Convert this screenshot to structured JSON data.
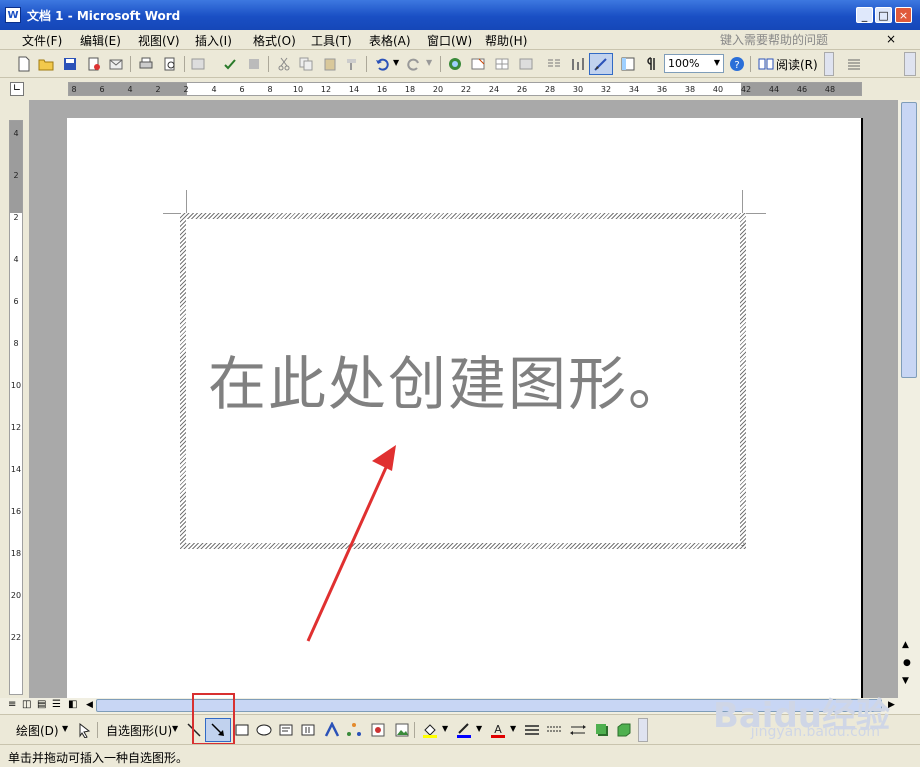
{
  "window": {
    "title": "文档 1 - Microsoft Word",
    "app_icon": "W",
    "min": "_",
    "max": "□",
    "close": "×"
  },
  "menu": {
    "items": [
      "文件(F)",
      "编辑(E)",
      "视图(V)",
      "插入(I)",
      "格式(O)",
      "工具(T)",
      "表格(A)",
      "窗口(W)",
      "帮助(H)"
    ],
    "help_placeholder": "键入需要帮助的问题",
    "help_close": "×"
  },
  "toolbar": {
    "zoom": "100%",
    "read_label": "阅读(R)"
  },
  "ruler": {
    "h_ticks": [
      "8",
      "6",
      "4",
      "2",
      "2",
      "4",
      "6",
      "8",
      "10",
      "12",
      "14",
      "16",
      "18",
      "20",
      "22",
      "24",
      "26",
      "28",
      "30",
      "32",
      "34",
      "36",
      "38",
      "40",
      "42",
      "44",
      "46",
      "48"
    ],
    "v_ticks": [
      "4",
      "2",
      "2",
      "4",
      "6",
      "8",
      "10",
      "12",
      "14",
      "16",
      "18",
      "20",
      "22"
    ]
  },
  "canvas": {
    "caption": "在此处创建图形。"
  },
  "drawing": {
    "draw_label": "绘图(D)",
    "autoshape_label": "自选图形(U)"
  },
  "status": {
    "text": "单击并拖动可插入一种自选图形。"
  },
  "watermark": {
    "main": "Baidu经验",
    "sub": "jingyan.baidu.com"
  },
  "colors": {
    "title_bar": "#1a4fc4",
    "highlight_box": "#d83030",
    "arrow": "#e03030",
    "font_red": "#e00000",
    "fill_yellow": "#ffff00",
    "line_blue": "#0000ff"
  }
}
